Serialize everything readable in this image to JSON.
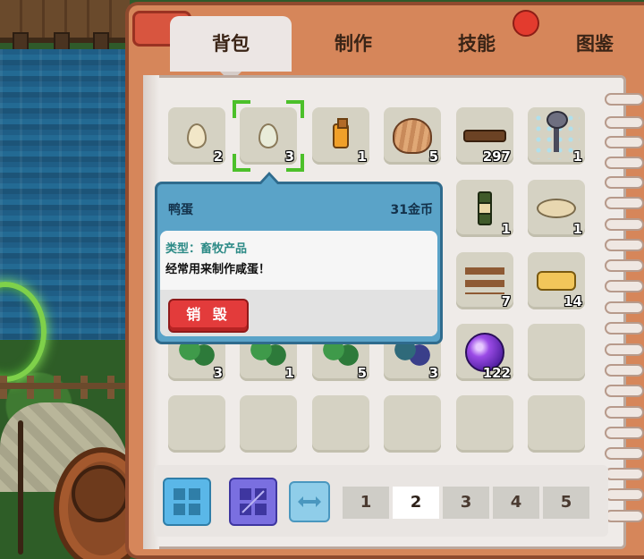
{
  "tabs": [
    {
      "label": "背包",
      "active": true
    },
    {
      "label": "制作",
      "active": false
    },
    {
      "label": "技能",
      "active": false
    },
    {
      "label": "图鉴",
      "active": false
    }
  ],
  "inventory": {
    "slots": [
      {
        "icon": "chicken-egg-icon",
        "qty": "2"
      },
      {
        "icon": "duck-egg-icon",
        "qty": "3",
        "selected": true
      },
      {
        "icon": "oil-bottle-icon",
        "qty": "1"
      },
      {
        "icon": "seashell-icon",
        "qty": "5"
      },
      {
        "icon": "wood-stick-icon",
        "qty": "297"
      },
      {
        "icon": "shovel-icon",
        "qty": "1"
      },
      {
        "icon": "wine-bottle-icon",
        "qty": "1"
      },
      {
        "icon": "flour-icon",
        "qty": "1"
      },
      {
        "icon": "wood-planks-icon",
        "qty": "7"
      },
      {
        "icon": "scroll-icon",
        "qty": "14"
      },
      {
        "icon": "green-herb-icon",
        "qty": "3"
      },
      {
        "icon": "leaf-herb-icon",
        "qty": "1"
      },
      {
        "icon": "seaweed-icon",
        "qty": "5"
      },
      {
        "icon": "dark-herb-icon",
        "qty": "3"
      },
      {
        "icon": "purple-orb-icon",
        "qty": "122"
      }
    ]
  },
  "tooltip": {
    "name": "鸭蛋",
    "price": "31金币",
    "type": "类型：畜牧产品",
    "description": "经常用来制作咸蛋！",
    "destroy_label": "销 毁"
  },
  "pagination": {
    "pages": [
      "1",
      "2",
      "3",
      "4",
      "5"
    ],
    "current": "2"
  },
  "view_buttons": [
    {
      "icon": "grid-four-icon"
    },
    {
      "icon": "grid-two-icon"
    },
    {
      "icon": "swap-arrows-icon"
    }
  ],
  "colors": {
    "accent_green": "#4cc02a",
    "tooltip_blue": "#5aa3c8",
    "destroy_red": "#e33b3b",
    "book_orange": "#d6865a"
  }
}
